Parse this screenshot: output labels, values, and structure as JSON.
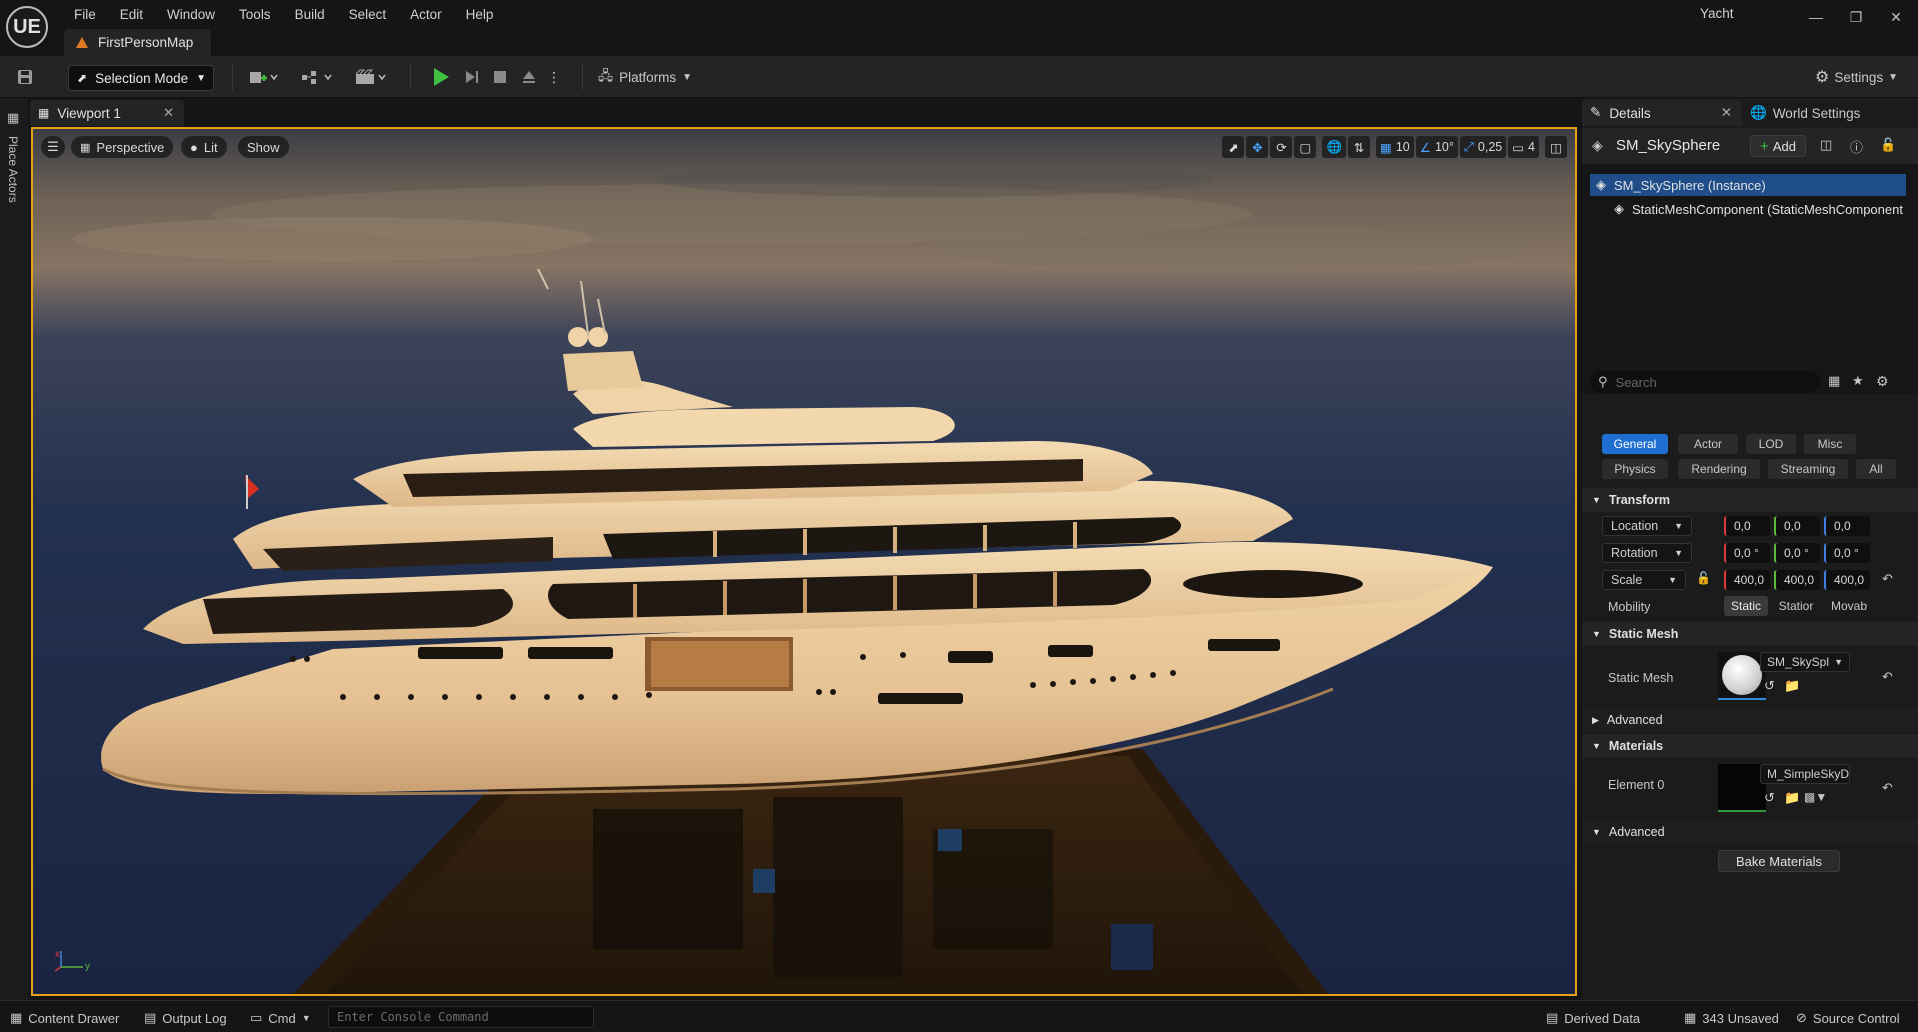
{
  "app": {
    "logo": "UE",
    "project_name": "Yacht",
    "map_tab": "FirstPersonMap"
  },
  "menu": [
    "File",
    "Edit",
    "Window",
    "Tools",
    "Build",
    "Select",
    "Actor",
    "Help"
  ],
  "toolbar": {
    "selection_mode": "Selection Mode",
    "platforms": "Platforms",
    "settings": "Settings"
  },
  "left_strip": {
    "place_actors": "Place Actors"
  },
  "viewport": {
    "tab_label": "Viewport 1",
    "perspective": "Perspective",
    "lit": "Lit",
    "show": "Show",
    "grid_snap": "10",
    "rotation_snap": "10°",
    "scale_snap": "0,25",
    "camera_speed": "4",
    "axis_x": "x",
    "axis_y": "y"
  },
  "details": {
    "tab_label": "Details",
    "world_tab_label": "World Settings",
    "actor_name": "SM_SkySphere",
    "add_label": "Add",
    "components": [
      "SM_SkySphere (Instance)",
      "StaticMeshComponent (StaticMeshComponent"
    ],
    "search_placeholder": "Search",
    "filters_row1": [
      "General",
      "Actor",
      "LOD",
      "Misc"
    ],
    "filters_row2": [
      "Physics",
      "Rendering",
      "Streaming",
      "All"
    ],
    "transform": {
      "header": "Transform",
      "location_label": "Location",
      "location": [
        "0,0",
        "0,0",
        "0,0"
      ],
      "rotation_label": "Rotation",
      "rotation": [
        "0,0 °",
        "0,0 °",
        "0,0 °"
      ],
      "scale_label": "Scale",
      "scale": [
        "400,0",
        "400,0",
        "400,0"
      ],
      "mobility_label": "Mobility",
      "mobility_options": [
        "Static",
        "Statior",
        "Movab"
      ]
    },
    "static_mesh": {
      "header": "Static Mesh",
      "label": "Static Mesh",
      "value": "SM_SkySpl",
      "advanced": "Advanced"
    },
    "materials": {
      "header": "Materials",
      "element_label": "Element 0",
      "value": "M_SimpleSkyDor",
      "advanced": "Advanced",
      "bake": "Bake Materials"
    }
  },
  "statusbar": {
    "content_drawer": "Content Drawer",
    "output_log": "Output Log",
    "cmd": "Cmd",
    "console_placeholder": "Enter Console Command",
    "derived_data": "Derived Data",
    "unsaved": "343 Unsaved",
    "source_control": "Source Control"
  },
  "colors": {
    "accent_blue": "#1f6fd1",
    "viewport_border": "#e4a018",
    "play_green": "#3fbf3f"
  }
}
